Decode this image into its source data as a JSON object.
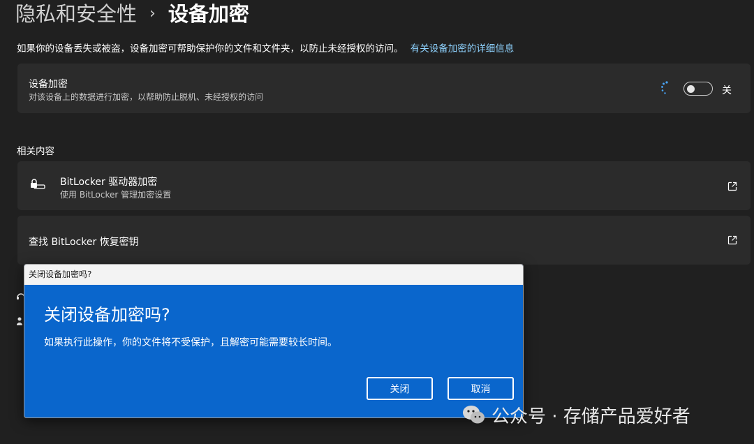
{
  "header": {
    "parent": "隐私和安全性",
    "separator": "›",
    "current": "设备加密"
  },
  "description": {
    "text": "如果你的设备丢失或被盗，设备加密可帮助保护你的文件和文件夹，以防止未经授权的访问。",
    "link": "有关设备加密的详细信息"
  },
  "device_encryption": {
    "title": "设备加密",
    "subtitle": "对该设备上的数据进行加密，以帮助防止脱机、未经授权的访问",
    "toggle_state_label": "关",
    "toggle_on": false
  },
  "related": {
    "section_title": "相关内容",
    "items": [
      {
        "title": "BitLocker 驱动器加密",
        "subtitle": "使用 BitLocker 管理加密设置",
        "icon": "drive-lock-icon"
      },
      {
        "title": "查找 BitLocker 恢复密钥",
        "icon": "external-link-icon"
      }
    ]
  },
  "dialog": {
    "window_title": "关闭设备加密吗?",
    "heading": "关闭设备加密吗?",
    "message": "如果执行此操作，你的文件将不受保护，且解密可能需要较长时间。",
    "confirm_label": "关闭",
    "cancel_label": "取消"
  },
  "watermark": {
    "text": "公众号 · 存储产品爱好者"
  },
  "colors": {
    "background": "#202020",
    "card": "#2b2b2b",
    "accent_link": "#8fd3ff",
    "dialog_blue": "#0a66cc"
  }
}
